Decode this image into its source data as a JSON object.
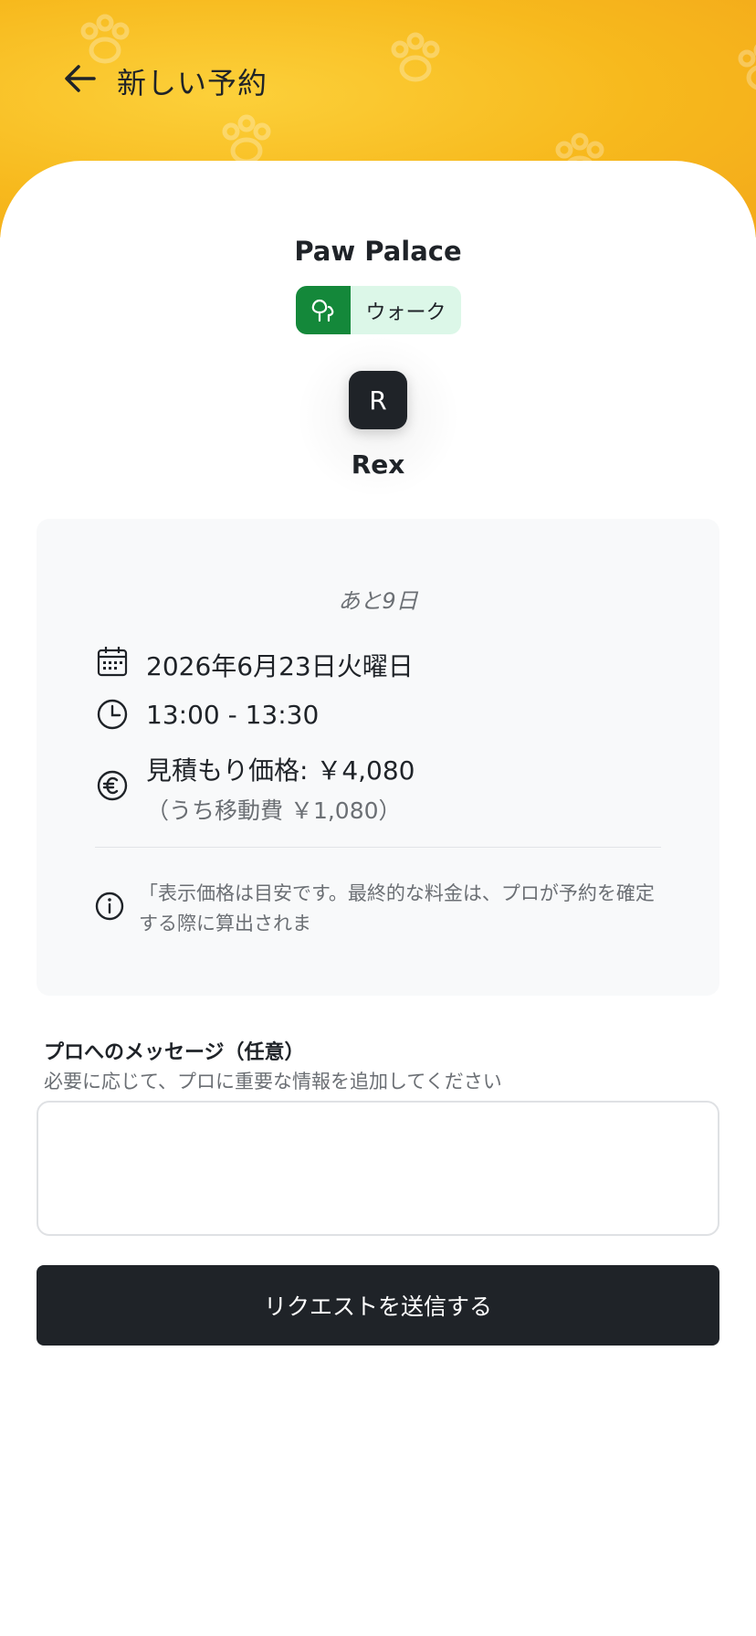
{
  "header": {
    "title": "新しい予約"
  },
  "provider": {
    "name": "Paw Palace"
  },
  "service": {
    "label": "ウォーク",
    "color": "#14883a",
    "bg": "#dcf7e8"
  },
  "pet": {
    "initial": "R",
    "name": "Rex"
  },
  "booking": {
    "days_left": "あと9日",
    "date": "2026年6月23日火曜日",
    "time": "13:00 - 13:30",
    "price": "見積もり価格: ￥4,080",
    "travel_fee": "（うち移動費 ￥1,080）",
    "note": "「表示価格は目安です。最終的な料金は、プロが予約を確定する際に算出されま"
  },
  "message": {
    "label": "プロへのメッセージ（任意）",
    "help": "必要に応じて、プロに重要な情報を追加してください",
    "value": "",
    "placeholder": ""
  },
  "submit": {
    "label": "リクエストを送信する"
  },
  "colors": {
    "header_bg": "#f7b91d",
    "primary_dark": "#1f2328"
  }
}
